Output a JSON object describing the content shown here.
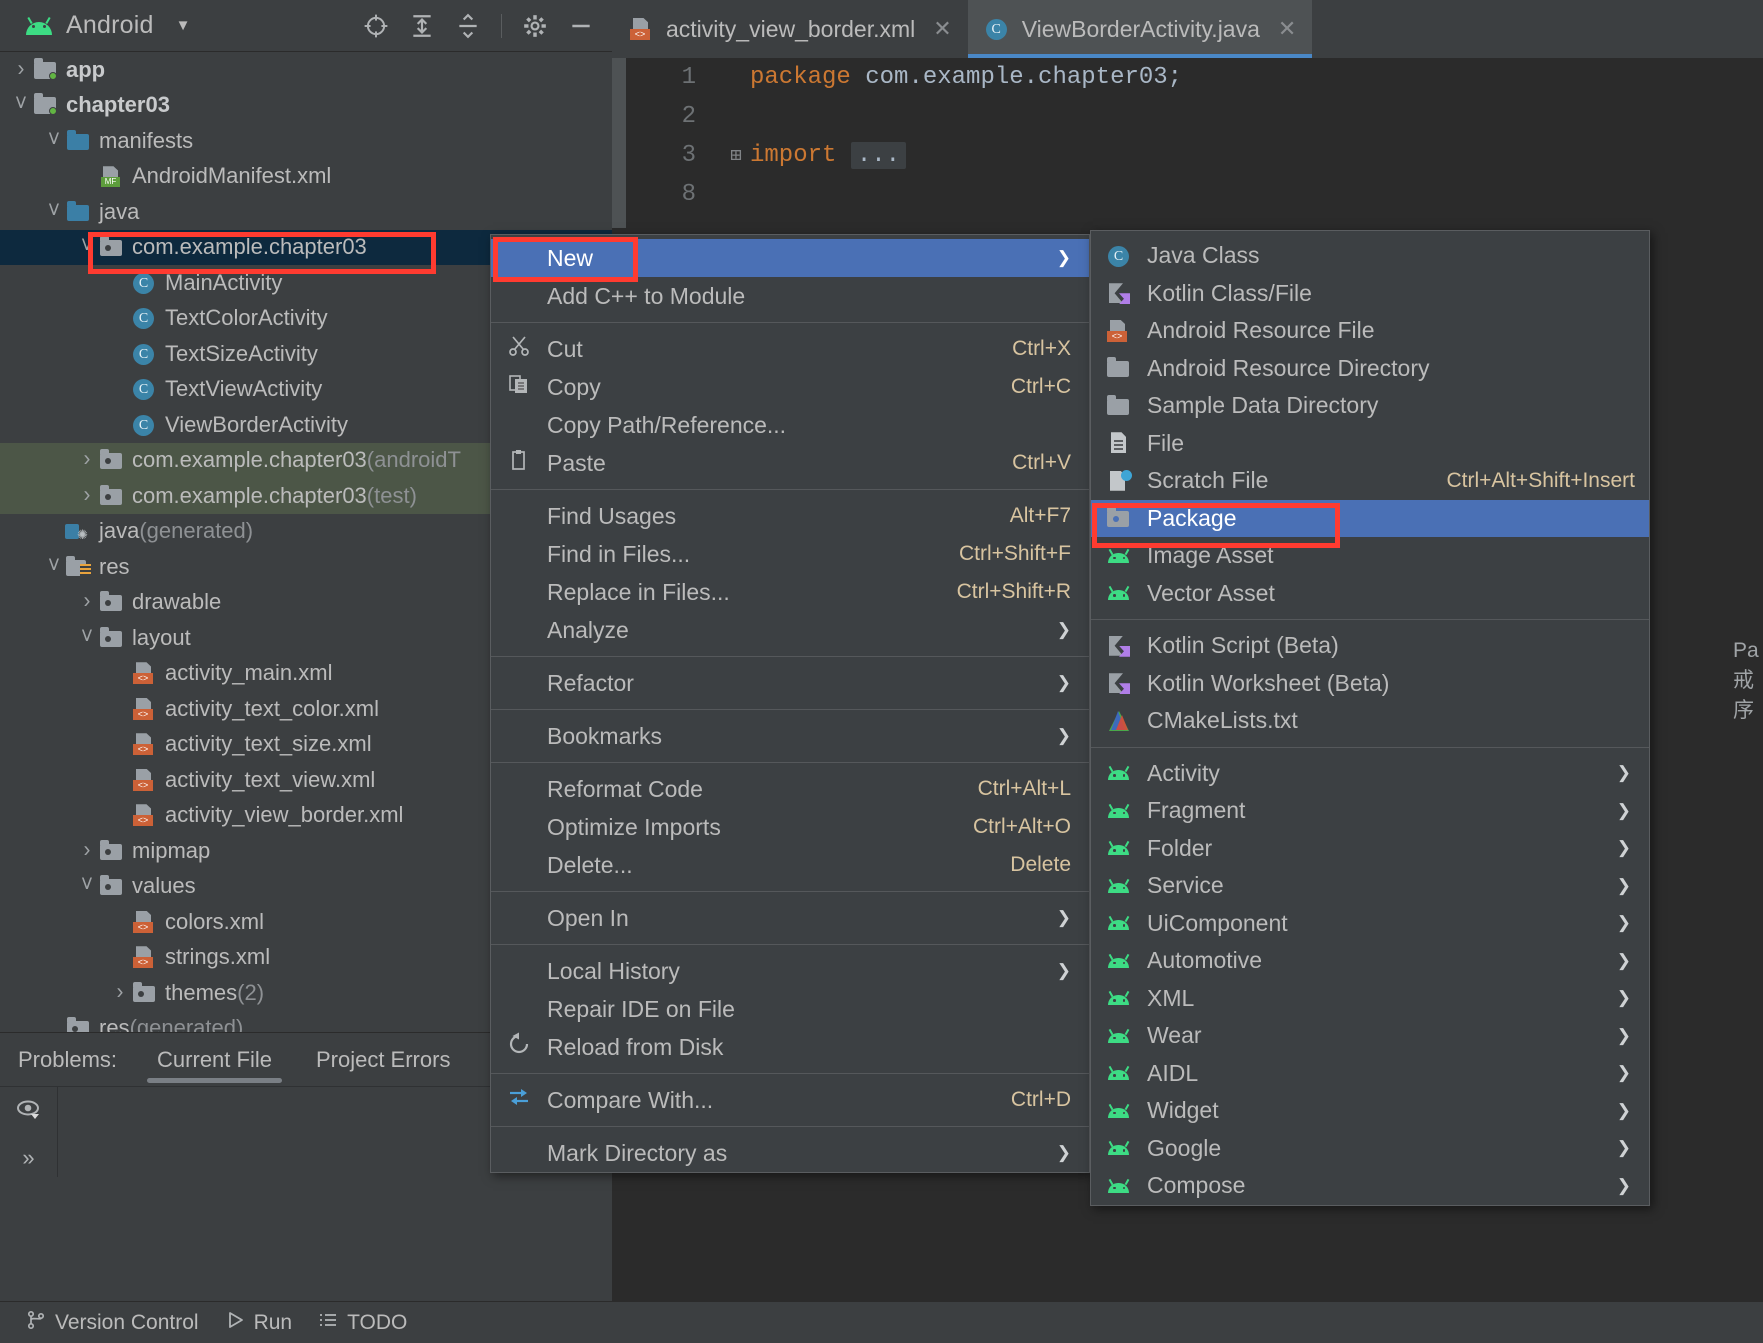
{
  "project_panel": {
    "title": "Android",
    "dropdown_icon": "chevron-down-icon",
    "toolbar_icons": [
      "locate-icon",
      "expand-all-icon",
      "collapse-all-icon",
      "settings-gear-icon",
      "minimize-icon"
    ],
    "tree": [
      {
        "indent": 0,
        "twisty": "›",
        "icon": "module",
        "label": "app",
        "bold": true,
        "state": "collapsed"
      },
      {
        "indent": 0,
        "twisty": "˅",
        "icon": "module",
        "label": "chapter03",
        "bold": true,
        "state": "expanded"
      },
      {
        "indent": 1,
        "twisty": "˅",
        "icon": "bfolder",
        "label": "manifests",
        "state": "expanded"
      },
      {
        "indent": 2,
        "twisty": "",
        "icon": "manifest",
        "label": "AndroidManifest.xml"
      },
      {
        "indent": 1,
        "twisty": "˅",
        "icon": "bfolder",
        "label": "java",
        "state": "expanded"
      },
      {
        "indent": 2,
        "twisty": "˅",
        "icon": "pkg",
        "label": "com.example.chapter03",
        "selected": true,
        "highlight_box": true,
        "state": "expanded"
      },
      {
        "indent": 3,
        "twisty": "",
        "icon": "cls",
        "label": "MainActivity"
      },
      {
        "indent": 3,
        "twisty": "",
        "icon": "cls",
        "label": "TextColorActivity"
      },
      {
        "indent": 3,
        "twisty": "",
        "icon": "cls",
        "label": "TextSizeActivity"
      },
      {
        "indent": 3,
        "twisty": "",
        "icon": "cls",
        "label": "TextViewActivity"
      },
      {
        "indent": 3,
        "twisty": "",
        "icon": "cls",
        "label": "ViewBorderActivity"
      },
      {
        "indent": 2,
        "twisty": "›",
        "icon": "pkg",
        "label": "com.example.chapter03",
        "suffix": " (androidT",
        "greenbg": true,
        "state": "collapsed"
      },
      {
        "indent": 2,
        "twisty": "›",
        "icon": "pkg",
        "label": "com.example.chapter03",
        "suffix": " (test)",
        "greenbg": true,
        "state": "collapsed"
      },
      {
        "indent": 1,
        "twisty": "",
        "icon": "gen",
        "label": "java",
        "suffix": " (generated)"
      },
      {
        "indent": 1,
        "twisty": "˅",
        "icon": "resf",
        "label": "res",
        "state": "expanded"
      },
      {
        "indent": 2,
        "twisty": "›",
        "icon": "pkg",
        "label": "drawable",
        "state": "collapsed"
      },
      {
        "indent": 2,
        "twisty": "˅",
        "icon": "pkg",
        "label": "layout",
        "state": "expanded"
      },
      {
        "indent": 3,
        "twisty": "",
        "icon": "xmlf",
        "label": "activity_main.xml"
      },
      {
        "indent": 3,
        "twisty": "",
        "icon": "xmlf",
        "label": "activity_text_color.xml"
      },
      {
        "indent": 3,
        "twisty": "",
        "icon": "xmlf",
        "label": "activity_text_size.xml"
      },
      {
        "indent": 3,
        "twisty": "",
        "icon": "xmlf",
        "label": "activity_text_view.xml"
      },
      {
        "indent": 3,
        "twisty": "",
        "icon": "xmlf",
        "label": "activity_view_border.xml"
      },
      {
        "indent": 2,
        "twisty": "›",
        "icon": "pkg",
        "label": "mipmap",
        "state": "collapsed"
      },
      {
        "indent": 2,
        "twisty": "˅",
        "icon": "pkg",
        "label": "values",
        "state": "expanded"
      },
      {
        "indent": 3,
        "twisty": "",
        "icon": "xmlf",
        "label": "colors.xml"
      },
      {
        "indent": 3,
        "twisty": "",
        "icon": "xmlf",
        "label": "strings.xml"
      },
      {
        "indent": 3,
        "twisty": "›",
        "icon": "pkg",
        "label": "themes",
        "suffix": " (2)",
        "state": "collapsed"
      },
      {
        "indent": 1,
        "twisty": "",
        "icon": "pkg",
        "label": "res",
        "suffix": " (generated)"
      }
    ]
  },
  "problems": {
    "label": "Problems:",
    "tabs": [
      {
        "label": "Current File",
        "active": true
      },
      {
        "label": "Project Errors",
        "active": false
      }
    ],
    "sidebar_icons": [
      "eye-preview-icon",
      "expand-more-icon"
    ]
  },
  "statusbar": {
    "items": [
      {
        "icon": "version-control-icon",
        "label": "Version Control"
      },
      {
        "icon": "run-play-icon",
        "label": "Run"
      },
      {
        "icon": "todo-list-icon",
        "label": "TODO"
      }
    ]
  },
  "editor": {
    "tabs": [
      {
        "label": "activity_view_border.xml",
        "icon": "xml-layout-icon",
        "active": false,
        "closable": true
      },
      {
        "label": "ViewBorderActivity.java",
        "icon": "java-class-icon",
        "active": true,
        "closable": true
      }
    ],
    "code_lines": [
      {
        "number": "1",
        "fold": "",
        "keyword": "package",
        "rest": " com.example.chapter03;"
      },
      {
        "number": "2",
        "fold": "",
        "keyword": "",
        "rest": ""
      },
      {
        "number": "3",
        "fold": "⊞",
        "keyword": "import",
        "rest": " ",
        "ellipsis": "..."
      },
      {
        "number": "8",
        "fold": "",
        "keyword": "",
        "rest": ""
      }
    ]
  },
  "right_remnant": [
    "Pa",
    "戒",
    "序"
  ],
  "context_menu": {
    "items": [
      {
        "label": "New",
        "icon": "",
        "shortcut": "",
        "arrow": true,
        "highlighted": true,
        "red_box": true
      },
      {
        "label": "Add C++ to Module",
        "icon": "",
        "shortcut": ""
      },
      {
        "separator": true
      },
      {
        "label": "Cut",
        "icon": "scissors-icon",
        "shortcut": "Ctrl+X",
        "mnemonic_last": true
      },
      {
        "label": "Copy",
        "icon": "copy-icon",
        "shortcut": "Ctrl+C",
        "mnemonic_first": true
      },
      {
        "label": "Copy Path/Reference...",
        "icon": "",
        "shortcut": ""
      },
      {
        "label": "Paste",
        "icon": "clipboard-icon",
        "shortcut": "Ctrl+V",
        "mnemonic_first": true
      },
      {
        "separator": true
      },
      {
        "label": "Find Usages",
        "icon": "",
        "shortcut": "Alt+F7"
      },
      {
        "label": "Find in Files...",
        "icon": "",
        "shortcut": "Ctrl+Shift+F"
      },
      {
        "label": "Replace in Files...",
        "icon": "",
        "shortcut": "Ctrl+Shift+R"
      },
      {
        "label": "Analyze",
        "icon": "",
        "shortcut": "",
        "arrow": true
      },
      {
        "separator": true
      },
      {
        "label": "Refactor",
        "icon": "",
        "shortcut": "",
        "arrow": true
      },
      {
        "separator": true
      },
      {
        "label": "Bookmarks",
        "icon": "",
        "shortcut": "",
        "arrow": true
      },
      {
        "separator": true
      },
      {
        "label": "Reformat Code",
        "icon": "",
        "shortcut": "Ctrl+Alt+L"
      },
      {
        "label": "Optimize Imports",
        "icon": "",
        "shortcut": "Ctrl+Alt+O"
      },
      {
        "label": "Delete...",
        "icon": "",
        "shortcut": "Delete"
      },
      {
        "separator": true
      },
      {
        "label": "Open In",
        "icon": "",
        "shortcut": "",
        "arrow": true
      },
      {
        "separator": true
      },
      {
        "label": "Local History",
        "icon": "",
        "shortcut": "",
        "arrow": true
      },
      {
        "label": "Repair IDE on File",
        "icon": "",
        "shortcut": ""
      },
      {
        "label": "Reload from Disk",
        "icon": "refresh-icon",
        "shortcut": ""
      },
      {
        "separator": true
      },
      {
        "label": "Compare With...",
        "icon": "compare-icon",
        "shortcut": "Ctrl+D"
      },
      {
        "separator": true
      },
      {
        "label": "Mark Directory as",
        "icon": "",
        "shortcut": "",
        "arrow": true
      }
    ]
  },
  "submenu": {
    "items": [
      {
        "label": "Java Class",
        "icon": "javac",
        "shortcut": ""
      },
      {
        "label": "Kotlin Class/File",
        "icon": "kotlin",
        "shortcut": ""
      },
      {
        "label": "Android Resource File",
        "icon": "xmlres",
        "shortcut": ""
      },
      {
        "label": "Android Resource Directory",
        "icon": "greyfolder",
        "shortcut": ""
      },
      {
        "label": "Sample Data Directory",
        "icon": "greyfolder",
        "shortcut": ""
      },
      {
        "label": "File",
        "icon": "plainfile",
        "shortcut": ""
      },
      {
        "label": "Scratch File",
        "icon": "scratch",
        "shortcut": "Ctrl+Alt+Shift+Insert"
      },
      {
        "label": "Package",
        "icon": "pkgfolder",
        "shortcut": "",
        "highlighted": true,
        "red_box": true
      },
      {
        "label": "Image Asset",
        "icon": "droid",
        "shortcut": ""
      },
      {
        "label": "Vector Asset",
        "icon": "droid",
        "shortcut": ""
      },
      {
        "separator": true
      },
      {
        "label": "Kotlin Script (Beta)",
        "icon": "kotlin",
        "shortcut": ""
      },
      {
        "label": "Kotlin Worksheet (Beta)",
        "icon": "kotlin",
        "shortcut": ""
      },
      {
        "label": "CMakeLists.txt",
        "icon": "cmake",
        "shortcut": ""
      },
      {
        "separator": true
      },
      {
        "label": "Activity",
        "icon": "droid",
        "shortcut": "",
        "arrow": true
      },
      {
        "label": "Fragment",
        "icon": "droid",
        "shortcut": "",
        "arrow": true
      },
      {
        "label": "Folder",
        "icon": "droid",
        "shortcut": "",
        "arrow": true
      },
      {
        "label": "Service",
        "icon": "droid",
        "shortcut": "",
        "arrow": true
      },
      {
        "label": "UiComponent",
        "icon": "droid",
        "shortcut": "",
        "arrow": true
      },
      {
        "label": "Automotive",
        "icon": "droid",
        "shortcut": "",
        "arrow": true
      },
      {
        "label": "XML",
        "icon": "droid",
        "shortcut": "",
        "arrow": true
      },
      {
        "label": "Wear",
        "icon": "droid",
        "shortcut": "",
        "arrow": true
      },
      {
        "label": "AIDL",
        "icon": "droid",
        "shortcut": "",
        "arrow": true
      },
      {
        "label": "Widget",
        "icon": "droid",
        "shortcut": "",
        "arrow": true
      },
      {
        "label": "Google",
        "icon": "droid",
        "shortcut": "",
        "arrow": true
      },
      {
        "label": "Compose",
        "icon": "droid",
        "shortcut": "",
        "arrow": true
      }
    ]
  },
  "colors": {
    "accent_selection": "#4a70b5",
    "highlight_red": "#ff3b30",
    "tree_selected": "#0d293e",
    "android_green": "#3ddc84",
    "panel_bg": "#3c3f41",
    "menu_bg": "#3c4043",
    "editor_bg": "#2b2b2b"
  }
}
